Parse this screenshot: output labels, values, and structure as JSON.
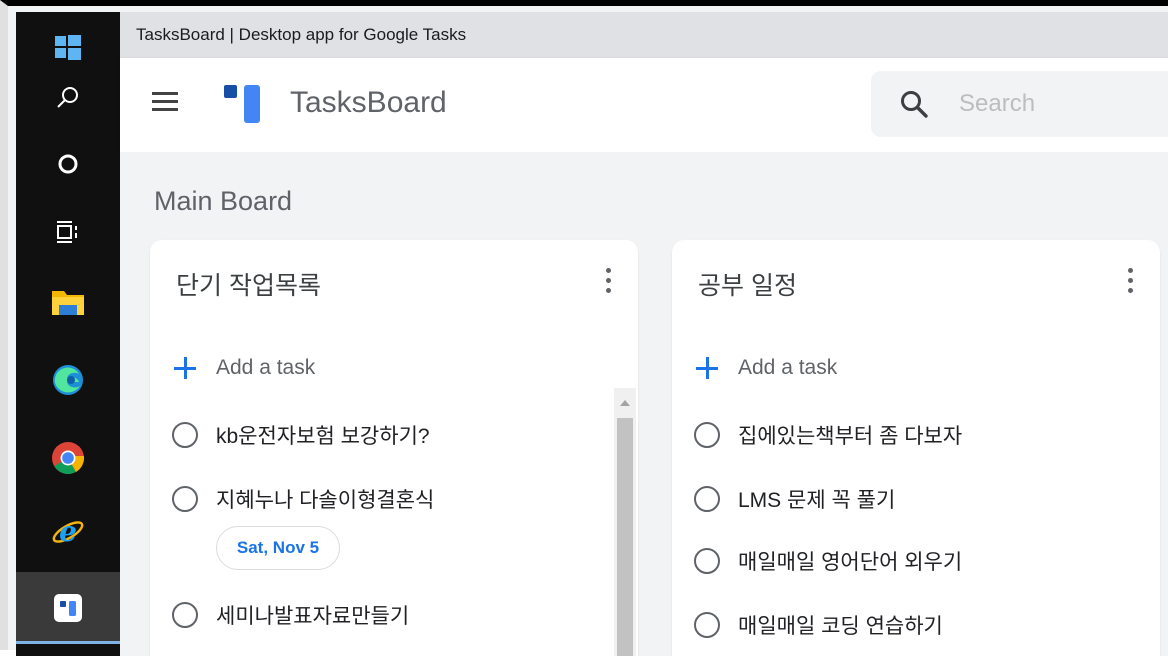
{
  "window": {
    "title": "TasksBoard | Desktop app for Google Tasks"
  },
  "taskbar": {
    "items": [
      {
        "name": "start",
        "icon": "windows-logo-icon"
      },
      {
        "name": "search",
        "icon": "search-icon"
      },
      {
        "name": "cortana",
        "icon": "cortana-ring-icon"
      },
      {
        "name": "task-view",
        "icon": "task-view-icon"
      },
      {
        "name": "file-explorer",
        "icon": "folder-icon"
      },
      {
        "name": "edge",
        "icon": "edge-icon"
      },
      {
        "name": "chrome",
        "icon": "chrome-icon"
      },
      {
        "name": "internet-explorer",
        "icon": "ie-icon"
      },
      {
        "name": "tasksboard",
        "icon": "tasksboard-icon",
        "active": true
      }
    ]
  },
  "header": {
    "app_name": "TasksBoard",
    "search_placeholder": "Search"
  },
  "board": {
    "title": "Main Board",
    "add_task_label": "Add a task",
    "lists": [
      {
        "title": "단기 작업목록",
        "tasks": [
          {
            "title": "kb운전자보험 보강하기?"
          },
          {
            "title": "지혜누나 다솔이형결혼식",
            "due": "Sat, Nov 5"
          },
          {
            "title": "세미나발표자료만들기"
          }
        ]
      },
      {
        "title": "공부 일정",
        "tasks": [
          {
            "title": "집에있는책부터 좀 다보자"
          },
          {
            "title": "LMS 문제 꼭 풀기"
          },
          {
            "title": "매일매일 영어단어 외우기"
          },
          {
            "title": "매일매일 코딩 연습하기"
          }
        ]
      }
    ]
  },
  "colors": {
    "accent": "#1a73e8",
    "logo_dark": "#174ea6",
    "logo_light": "#4285f4",
    "taskbar": "#101010"
  }
}
